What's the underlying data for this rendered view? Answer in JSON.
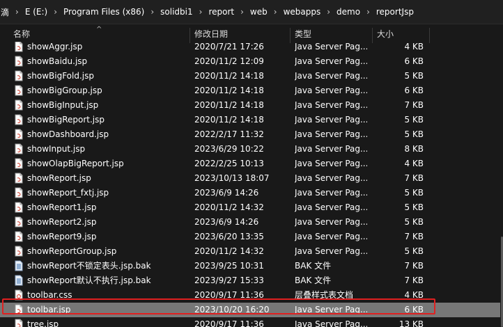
{
  "breadcrumb": [
    "滴",
    "E (E:)",
    "Program Files (x86)",
    "solidbi1",
    "report",
    "web",
    "webapps",
    "demo",
    "reportJsp"
  ],
  "columns": {
    "name": "名称",
    "date": "修改日期",
    "type": "类型",
    "size": "大小"
  },
  "colors": {
    "background": "#191919",
    "selected_row": "#777777",
    "highlight_border": "#e02020"
  },
  "files": [
    {
      "name": "showAggr.jsp",
      "date": "2020/7/21 17:26",
      "type": "Java Server Pag...",
      "size": "4 KB",
      "icon": "jsp-file-icon"
    },
    {
      "name": "showBaidu.jsp",
      "date": "2020/11/2 12:09",
      "type": "Java Server Pag...",
      "size": "6 KB",
      "icon": "jsp-file-icon"
    },
    {
      "name": "showBigFold.jsp",
      "date": "2020/11/2 14:18",
      "type": "Java Server Pag...",
      "size": "5 KB",
      "icon": "jsp-file-icon"
    },
    {
      "name": "showBigGroup.jsp",
      "date": "2020/11/2 14:18",
      "type": "Java Server Pag...",
      "size": "6 KB",
      "icon": "jsp-file-icon"
    },
    {
      "name": "showBigInput.jsp",
      "date": "2020/11/2 14:18",
      "type": "Java Server Pag...",
      "size": "7 KB",
      "icon": "jsp-file-icon"
    },
    {
      "name": "showBigReport.jsp",
      "date": "2020/11/2 14:18",
      "type": "Java Server Pag...",
      "size": "5 KB",
      "icon": "jsp-file-icon"
    },
    {
      "name": "showDashboard.jsp",
      "date": "2022/2/17 11:32",
      "type": "Java Server Pag...",
      "size": "5 KB",
      "icon": "jsp-file-icon"
    },
    {
      "name": "showInput.jsp",
      "date": "2023/6/29 10:22",
      "type": "Java Server Pag...",
      "size": "8 KB",
      "icon": "jsp-file-icon"
    },
    {
      "name": "showOlapBigReport.jsp",
      "date": "2022/2/25 10:13",
      "type": "Java Server Pag...",
      "size": "4 KB",
      "icon": "jsp-file-icon"
    },
    {
      "name": "showReport.jsp",
      "date": "2023/10/13 18:07",
      "type": "Java Server Pag...",
      "size": "7 KB",
      "icon": "jsp-file-icon"
    },
    {
      "name": "showReport_fxtj.jsp",
      "date": "2023/6/9 14:26",
      "type": "Java Server Pag...",
      "size": "5 KB",
      "icon": "jsp-file-icon"
    },
    {
      "name": "showReport1.jsp",
      "date": "2020/11/2 14:32",
      "type": "Java Server Pag...",
      "size": "5 KB",
      "icon": "jsp-file-icon"
    },
    {
      "name": "showReport2.jsp",
      "date": "2023/6/9 14:26",
      "type": "Java Server Pag...",
      "size": "5 KB",
      "icon": "jsp-file-icon"
    },
    {
      "name": "showReport9.jsp",
      "date": "2023/6/20 13:35",
      "type": "Java Server Pag...",
      "size": "7 KB",
      "icon": "jsp-file-icon"
    },
    {
      "name": "showReportGroup.jsp",
      "date": "2020/11/2 14:32",
      "type": "Java Server Pag...",
      "size": "5 KB",
      "icon": "jsp-file-icon"
    },
    {
      "name": "showReport不锁定表头.jsp.bak",
      "date": "2023/9/25 10:31",
      "type": "BAK 文件",
      "size": "7 KB",
      "icon": "bak-file-icon"
    },
    {
      "name": "showReport默认不执行.jsp.bak",
      "date": "2023/9/27 15:33",
      "type": "BAK 文件",
      "size": "7 KB",
      "icon": "bak-file-icon"
    },
    {
      "name": "toolbar.css",
      "date": "2020/9/17 11:36",
      "type": "层叠样式表文档",
      "size": "4 KB",
      "icon": "css-file-icon"
    },
    {
      "name": "toolbar.jsp",
      "date": "2023/10/20 16:20",
      "type": "Java Server Pag...",
      "size": "6 KB",
      "icon": "jsp-file-icon",
      "selected": true
    },
    {
      "name": "tree.jsp",
      "date": "2020/9/17 11:36",
      "type": "Java Server Pag...",
      "size": "13 KB",
      "icon": "jsp-file-icon"
    }
  ]
}
